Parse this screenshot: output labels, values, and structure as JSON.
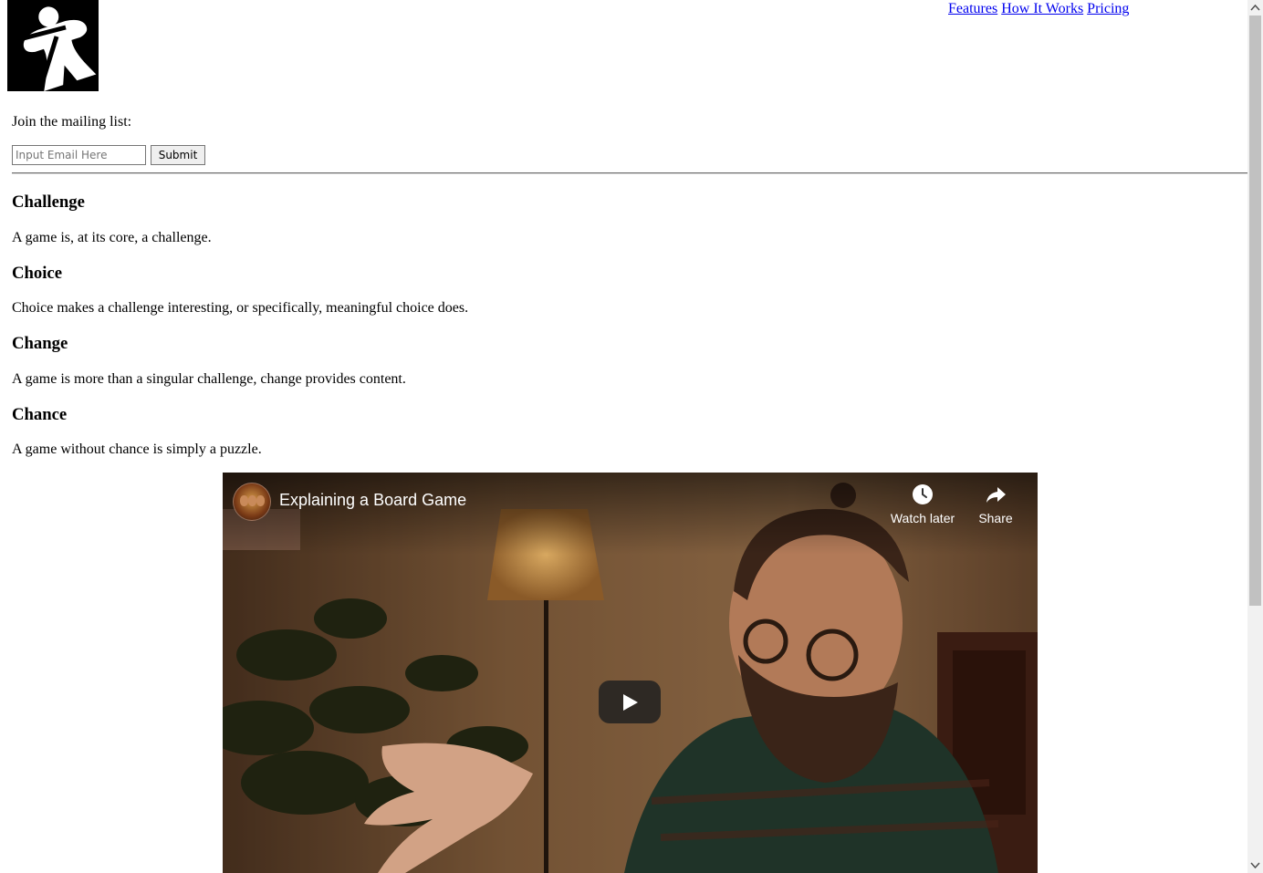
{
  "header": {
    "logo": "meeple-logo",
    "nav": [
      {
        "label": "Features"
      },
      {
        "label": "How It Works"
      },
      {
        "label": "Pricing"
      }
    ]
  },
  "mailing": {
    "label": "Join the mailing list:",
    "email_placeholder": "Input Email Here",
    "email_value": "",
    "submit_label": "Submit"
  },
  "sections": [
    {
      "title": "Challenge",
      "text": "A game is, at its core, a challenge."
    },
    {
      "title": "Choice",
      "text": "Choice makes a challenge interesting, or specifically, meaningful choice does."
    },
    {
      "title": "Change",
      "text": "A game is more than a singular challenge, change provides content."
    },
    {
      "title": "Chance",
      "text": "A game without chance is simply a puzzle."
    }
  ],
  "video": {
    "title": "Explaining a Board Game",
    "watch_later_label": "Watch later",
    "share_label": "Share",
    "watch_later_icon": "clock-icon",
    "share_icon": "share-arrow-icon",
    "play_icon": "play-icon"
  },
  "colors": {
    "link": "#0000ee",
    "logo_bg": "#000000",
    "rule": "#6e6e6e"
  }
}
